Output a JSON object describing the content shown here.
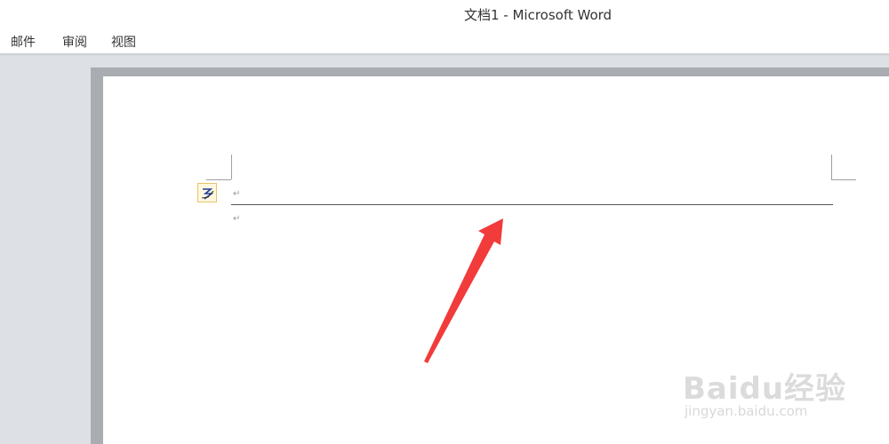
{
  "window": {
    "title": "文档1 - Microsoft Word"
  },
  "ribbon": {
    "tabs": [
      {
        "label": "邮件"
      },
      {
        "label": "审阅"
      },
      {
        "label": "视图"
      }
    ]
  },
  "document": {
    "paragraph_mark": "↵"
  },
  "icons": {
    "autoformat": "autocorrect-options-icon",
    "annotation": "red-arrow-annotation"
  },
  "colors": {
    "annotation_arrow": "#f23b3b",
    "workspace_bg": "#dde0e4",
    "page_bg": "#ffffff"
  },
  "watermark": {
    "logo_text": "Baidu经验",
    "url": "jingyan.baidu.com"
  }
}
